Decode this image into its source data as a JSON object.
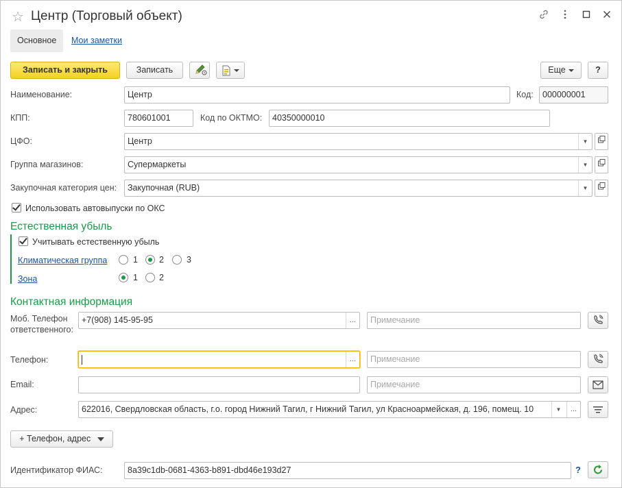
{
  "window": {
    "title": "Центр (Торговый объект)",
    "controls": [
      "link-icon",
      "more-icon",
      "maximize-icon",
      "close-icon"
    ]
  },
  "tabs": [
    {
      "label": "Основное",
      "active": true
    },
    {
      "label": "Мои заметки",
      "active": false
    }
  ],
  "toolbar": {
    "save_close": "Записать и закрыть",
    "save": "Записать",
    "more": "Еще",
    "help": "?"
  },
  "form": {
    "name_label": "Наименование:",
    "name_value": "Центр",
    "code_label": "Код:",
    "code_value": "000000001",
    "kpp_label": "КПП:",
    "kpp_value": "780601001",
    "oktmo_label": "Код по ОКТМО:",
    "oktmo_value": "40350000010",
    "cfo_label": "ЦФО:",
    "cfo_value": "Центр",
    "group_label": "Группа магазинов:",
    "group_value": "Супермаркеты",
    "price_cat_label": "Закупочная категория цен:",
    "price_cat_value": "Закупочная (RUB)",
    "autorelease_label": "Использовать автовыпуски по ОКС",
    "autorelease_checked": true
  },
  "natural_loss": {
    "heading": "Естественная убыль",
    "consider_label": "Учитывать естественную убыль",
    "consider_checked": true,
    "climate_label": "Климатическая группа",
    "climate_options": [
      "1",
      "2",
      "3"
    ],
    "climate_selected": "2",
    "zone_label": "Зона",
    "zone_options": [
      "1",
      "2"
    ],
    "zone_selected": "1"
  },
  "contacts": {
    "heading": "Контактная информация",
    "mobile_label": "Моб. Телефон ответственного:",
    "mobile_value": "+7(908) 145-95-95",
    "note_placeholder": "Примечание",
    "phone_label": "Телефон:",
    "phone_value": "",
    "email_label": "Email:",
    "email_value": "",
    "address_label": "Адрес:",
    "address_value": "622016, Свердловская область, г.о. город Нижний Тагил, г Нижний Тагил, ул Красноармейская, д. 196, помещ. 10",
    "ellipsis": "...",
    "add_button": "+ Телефон, адрес"
  },
  "fias": {
    "label": "Идентификатор ФИАС:",
    "value": "8a39c1db-0681-4363-b891-dbd46e193d27",
    "help": "?"
  },
  "colors": {
    "accent_green": "#1a9a48",
    "primary_yellow": "#f5d021",
    "link_blue": "#1a55a0",
    "focus_orange": "#f0b400"
  }
}
